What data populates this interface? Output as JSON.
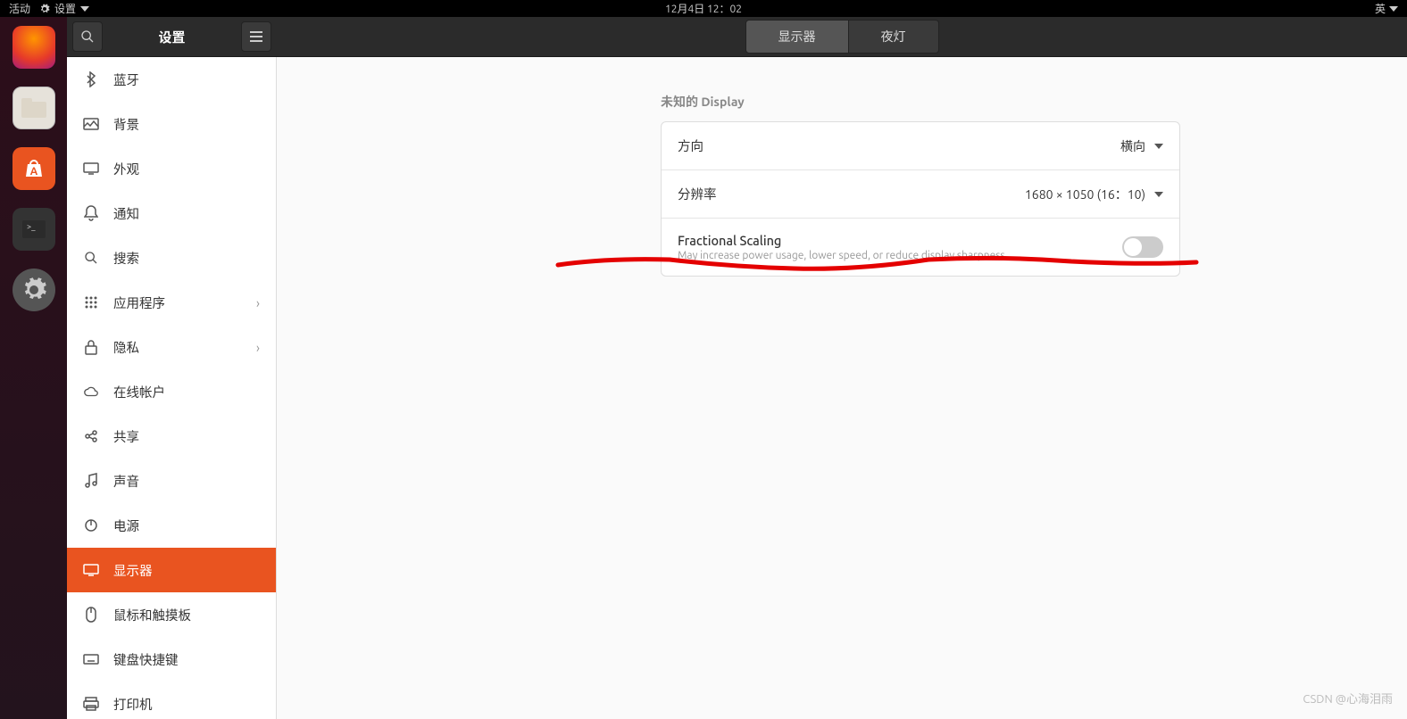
{
  "topbar": {
    "activities": "活动",
    "app_name": "设置",
    "datetime": "12月4日  12：02",
    "ime": "英"
  },
  "header": {
    "title": "设置",
    "tabs": {
      "display": "显示器",
      "night": "夜灯"
    }
  },
  "sidebar": {
    "items": [
      {
        "icon": "bluetooth",
        "label": "蓝牙"
      },
      {
        "icon": "background",
        "label": "背景"
      },
      {
        "icon": "appearance",
        "label": "外观"
      },
      {
        "icon": "notifications",
        "label": "通知"
      },
      {
        "icon": "search",
        "label": "搜索"
      },
      {
        "icon": "apps",
        "label": "应用程序",
        "chevron": true
      },
      {
        "icon": "privacy",
        "label": "隐私",
        "chevron": true
      },
      {
        "icon": "online",
        "label": "在线帐户"
      },
      {
        "icon": "sharing",
        "label": "共享"
      },
      {
        "icon": "sound",
        "label": "声音"
      },
      {
        "icon": "power",
        "label": "电源"
      },
      {
        "icon": "display",
        "label": "显示器",
        "selected": true
      },
      {
        "icon": "mouse",
        "label": "鼠标和触摸板"
      },
      {
        "icon": "keyboard",
        "label": "键盘快捷键"
      },
      {
        "icon": "printer",
        "label": "打印机"
      }
    ]
  },
  "content": {
    "section_title": "未知的 Display",
    "orientation": {
      "label": "方向",
      "value": "横向"
    },
    "resolution": {
      "label": "分辨率",
      "value": "1680 × 1050 (16：10)"
    },
    "fractional": {
      "title": "Fractional Scaling",
      "desc": "May increase power usage, lower speed, or reduce display sharpness."
    }
  },
  "watermark": "CSDN @心海泪雨"
}
